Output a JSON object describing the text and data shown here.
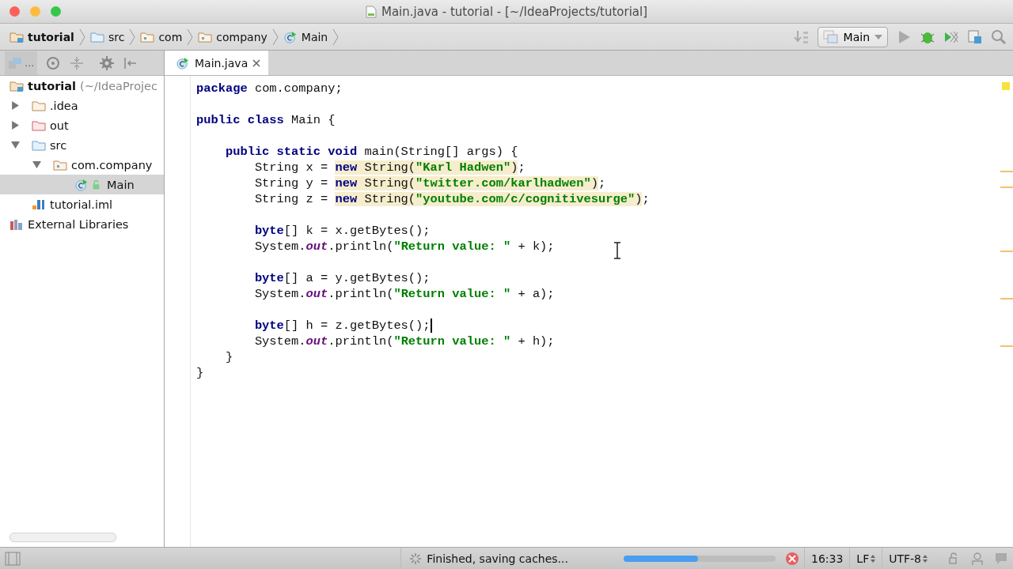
{
  "window": {
    "title": "Main.java - tutorial - [~/IdeaProjects/tutorial]"
  },
  "breadcrumbs": [
    {
      "label": "tutorial",
      "kind": "module"
    },
    {
      "label": "src",
      "kind": "source-folder"
    },
    {
      "label": "com",
      "kind": "package"
    },
    {
      "label": "company",
      "kind": "package"
    },
    {
      "label": "Main",
      "kind": "class"
    }
  ],
  "toolbar": {
    "run_configuration": "Main"
  },
  "project_panel": {
    "view_selector": "...",
    "tree": [
      {
        "label": "tutorial",
        "suffix": "(~/IdeaProjec",
        "kind": "module",
        "selected": false,
        "children": [
          {
            "label": ".idea",
            "kind": "folder",
            "expanded": false,
            "selected": false
          },
          {
            "label": "out",
            "kind": "excluded-folder",
            "expanded": false,
            "selected": false
          },
          {
            "label": "src",
            "kind": "source-folder",
            "expanded": true,
            "selected": false,
            "children": [
              {
                "label": "com.company",
                "kind": "package",
                "expanded": true,
                "selected": false,
                "children": [
                  {
                    "label": "Main",
                    "kind": "class",
                    "selected": true
                  }
                ]
              }
            ]
          },
          {
            "label": "tutorial.iml",
            "kind": "iml",
            "selected": false
          }
        ]
      },
      {
        "label": "External Libraries",
        "kind": "libraries",
        "selected": false
      }
    ]
  },
  "editor": {
    "tabs": [
      {
        "label": "Main.java",
        "selected": true
      }
    ],
    "lines": [
      {
        "caret": false,
        "tokens": [
          {
            "kind": "keyword",
            "text": "package"
          },
          {
            "kind": "text",
            "text": " com.company;"
          }
        ]
      },
      {
        "kind": "blank"
      },
      {
        "caret": false,
        "tokens": [
          {
            "kind": "keyword",
            "text": "public class"
          },
          {
            "kind": "text",
            "text": " Main {"
          }
        ]
      },
      {
        "kind": "blank"
      },
      {
        "caret": false,
        "tokens": [
          {
            "kind": "keyword",
            "text": "    public static void"
          },
          {
            "kind": "text",
            "text": " main(String[] args) {"
          }
        ]
      },
      {
        "caret": false,
        "tokens": [
          {
            "kind": "text",
            "text": "        String x = "
          },
          {
            "kind": "highlighted-keyword",
            "text": "new"
          },
          {
            "kind": "highlighted-text",
            "text": " String("
          },
          {
            "kind": "highlighted-string",
            "text": "\"Karl Hadwen\""
          },
          {
            "kind": "highlighted-text",
            "text": ")"
          },
          {
            "kind": "text",
            "text": ";"
          }
        ]
      },
      {
        "caret": false,
        "tokens": [
          {
            "kind": "text",
            "text": "        String y = "
          },
          {
            "kind": "highlighted-keyword",
            "text": "new"
          },
          {
            "kind": "highlighted-text",
            "text": " String("
          },
          {
            "kind": "highlighted-string",
            "text": "\"twitter.com/karlhadwen\""
          },
          {
            "kind": "highlighted-text",
            "text": ")"
          },
          {
            "kind": "text",
            "text": ";"
          }
        ]
      },
      {
        "caret": false,
        "tokens": [
          {
            "kind": "text",
            "text": "        String z = "
          },
          {
            "kind": "highlighted-keyword",
            "text": "new"
          },
          {
            "kind": "highlighted-text",
            "text": " String("
          },
          {
            "kind": "highlighted-string",
            "text": "\"youtube.com/c/cognitivesurge\""
          },
          {
            "kind": "highlighted-text",
            "text": ")"
          },
          {
            "kind": "text",
            "text": ";"
          }
        ]
      },
      {
        "kind": "blank"
      },
      {
        "caret": false,
        "tokens": [
          {
            "kind": "keyword",
            "text": "        byte"
          },
          {
            "kind": "text",
            "text": "[] k = x.getBytes();"
          }
        ]
      },
      {
        "caret": false,
        "tokens": [
          {
            "kind": "text",
            "text": "        System."
          },
          {
            "kind": "static-field",
            "text": "out"
          },
          {
            "kind": "text",
            "text": ".println("
          },
          {
            "kind": "string",
            "text": "\"Return value: \""
          },
          {
            "kind": "text",
            "text": " + k);"
          }
        ]
      },
      {
        "kind": "blank"
      },
      {
        "caret": false,
        "tokens": [
          {
            "kind": "keyword",
            "text": "        byte"
          },
          {
            "kind": "text",
            "text": "[] a = y.getBytes();"
          }
        ]
      },
      {
        "caret": false,
        "tokens": [
          {
            "kind": "text",
            "text": "        System."
          },
          {
            "kind": "static-field",
            "text": "out"
          },
          {
            "kind": "text",
            "text": ".println("
          },
          {
            "kind": "string",
            "text": "\"Return value: \""
          },
          {
            "kind": "text",
            "text": " + a);"
          }
        ]
      },
      {
        "kind": "blank"
      },
      {
        "caret": true,
        "tokens": [
          {
            "kind": "keyword",
            "text": "        byte"
          },
          {
            "kind": "text",
            "text": "[] h = z.getBytes();"
          }
        ]
      },
      {
        "caret": false,
        "tokens": [
          {
            "kind": "text",
            "text": "        System."
          },
          {
            "kind": "static-field",
            "text": "out"
          },
          {
            "kind": "text",
            "text": ".println("
          },
          {
            "kind": "string",
            "text": "\"Return value: \""
          },
          {
            "kind": "text",
            "text": " + h);"
          }
        ]
      },
      {
        "caret": false,
        "tokens": [
          {
            "kind": "text",
            "text": "    }"
          }
        ]
      },
      {
        "caret": false,
        "tokens": [
          {
            "kind": "text",
            "text": "}"
          }
        ]
      }
    ]
  },
  "status_bar": {
    "message": "Finished, saving caches...",
    "progress": {
      "level": 0.49
    },
    "position": "16:33",
    "line_separator": "LF",
    "encoding": "UTF-8"
  }
}
